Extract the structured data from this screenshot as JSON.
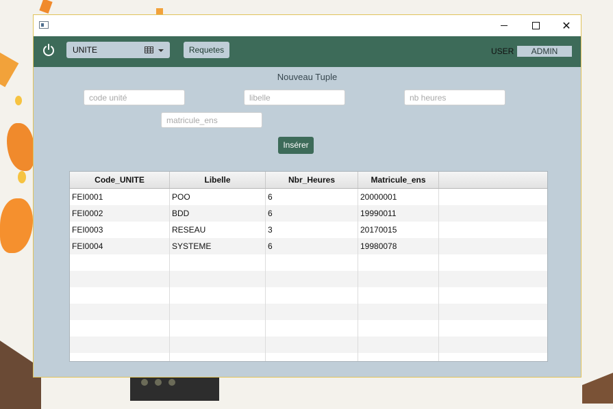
{
  "window": {
    "controls": {
      "minimize": "—",
      "maximize": "☐",
      "close": "✕"
    }
  },
  "toolbar": {
    "power_icon": "power-icon",
    "table_select": {
      "selected": "UNITE",
      "icon": "table-grid-icon"
    },
    "requetes_label": "Requetes",
    "user_label": "USER",
    "user_value": "ADMIN"
  },
  "form": {
    "title": "Nouveau Tuple",
    "code_placeholder": "code unité",
    "libelle_placeholder": "libelle",
    "heures_placeholder": "nb heures",
    "matricule_placeholder": "matricule_ens",
    "insert_label": "Insérer"
  },
  "table": {
    "headers": [
      "Code_UNITE",
      "Libelle",
      "Nbr_Heures",
      "Matricule_ens"
    ],
    "rows": [
      [
        "FEI0001",
        "POO",
        "6",
        "20000001"
      ],
      [
        "FEI0002",
        "BDD",
        "6",
        "19990011"
      ],
      [
        "FEI0003",
        "RESEAU",
        "3",
        "20170015"
      ],
      [
        "FEI0004",
        "SYSTEME",
        "6",
        "19980078"
      ]
    ]
  },
  "colors": {
    "accent": "#3d6b59",
    "background": "#c0ced8"
  }
}
